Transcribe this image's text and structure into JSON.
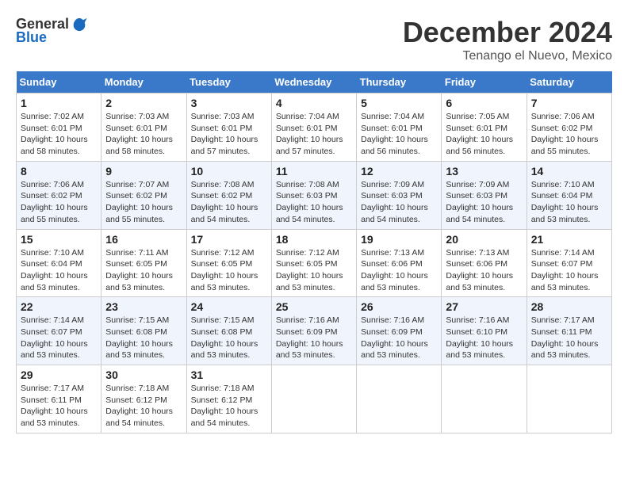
{
  "header": {
    "logo_general": "General",
    "logo_blue": "Blue",
    "month_title": "December 2024",
    "location": "Tenango el Nuevo, Mexico"
  },
  "days_of_week": [
    "Sunday",
    "Monday",
    "Tuesday",
    "Wednesday",
    "Thursday",
    "Friday",
    "Saturday"
  ],
  "weeks": [
    [
      {
        "date": "1",
        "sunrise": "7:02 AM",
        "sunset": "6:01 PM",
        "daylight": "10 hours and 58 minutes."
      },
      {
        "date": "2",
        "sunrise": "7:03 AM",
        "sunset": "6:01 PM",
        "daylight": "10 hours and 58 minutes."
      },
      {
        "date": "3",
        "sunrise": "7:03 AM",
        "sunset": "6:01 PM",
        "daylight": "10 hours and 57 minutes."
      },
      {
        "date": "4",
        "sunrise": "7:04 AM",
        "sunset": "6:01 PM",
        "daylight": "10 hours and 57 minutes."
      },
      {
        "date": "5",
        "sunrise": "7:04 AM",
        "sunset": "6:01 PM",
        "daylight": "10 hours and 56 minutes."
      },
      {
        "date": "6",
        "sunrise": "7:05 AM",
        "sunset": "6:01 PM",
        "daylight": "10 hours and 56 minutes."
      },
      {
        "date": "7",
        "sunrise": "7:06 AM",
        "sunset": "6:02 PM",
        "daylight": "10 hours and 55 minutes."
      }
    ],
    [
      {
        "date": "8",
        "sunrise": "7:06 AM",
        "sunset": "6:02 PM",
        "daylight": "10 hours and 55 minutes."
      },
      {
        "date": "9",
        "sunrise": "7:07 AM",
        "sunset": "6:02 PM",
        "daylight": "10 hours and 55 minutes."
      },
      {
        "date": "10",
        "sunrise": "7:08 AM",
        "sunset": "6:02 PM",
        "daylight": "10 hours and 54 minutes."
      },
      {
        "date": "11",
        "sunrise": "7:08 AM",
        "sunset": "6:03 PM",
        "daylight": "10 hours and 54 minutes."
      },
      {
        "date": "12",
        "sunrise": "7:09 AM",
        "sunset": "6:03 PM",
        "daylight": "10 hours and 54 minutes."
      },
      {
        "date": "13",
        "sunrise": "7:09 AM",
        "sunset": "6:03 PM",
        "daylight": "10 hours and 54 minutes."
      },
      {
        "date": "14",
        "sunrise": "7:10 AM",
        "sunset": "6:04 PM",
        "daylight": "10 hours and 53 minutes."
      }
    ],
    [
      {
        "date": "15",
        "sunrise": "7:10 AM",
        "sunset": "6:04 PM",
        "daylight": "10 hours and 53 minutes."
      },
      {
        "date": "16",
        "sunrise": "7:11 AM",
        "sunset": "6:05 PM",
        "daylight": "10 hours and 53 minutes."
      },
      {
        "date": "17",
        "sunrise": "7:12 AM",
        "sunset": "6:05 PM",
        "daylight": "10 hours and 53 minutes."
      },
      {
        "date": "18",
        "sunrise": "7:12 AM",
        "sunset": "6:05 PM",
        "daylight": "10 hours and 53 minutes."
      },
      {
        "date": "19",
        "sunrise": "7:13 AM",
        "sunset": "6:06 PM",
        "daylight": "10 hours and 53 minutes."
      },
      {
        "date": "20",
        "sunrise": "7:13 AM",
        "sunset": "6:06 PM",
        "daylight": "10 hours and 53 minutes."
      },
      {
        "date": "21",
        "sunrise": "7:14 AM",
        "sunset": "6:07 PM",
        "daylight": "10 hours and 53 minutes."
      }
    ],
    [
      {
        "date": "22",
        "sunrise": "7:14 AM",
        "sunset": "6:07 PM",
        "daylight": "10 hours and 53 minutes."
      },
      {
        "date": "23",
        "sunrise": "7:15 AM",
        "sunset": "6:08 PM",
        "daylight": "10 hours and 53 minutes."
      },
      {
        "date": "24",
        "sunrise": "7:15 AM",
        "sunset": "6:08 PM",
        "daylight": "10 hours and 53 minutes."
      },
      {
        "date": "25",
        "sunrise": "7:16 AM",
        "sunset": "6:09 PM",
        "daylight": "10 hours and 53 minutes."
      },
      {
        "date": "26",
        "sunrise": "7:16 AM",
        "sunset": "6:09 PM",
        "daylight": "10 hours and 53 minutes."
      },
      {
        "date": "27",
        "sunrise": "7:16 AM",
        "sunset": "6:10 PM",
        "daylight": "10 hours and 53 minutes."
      },
      {
        "date": "28",
        "sunrise": "7:17 AM",
        "sunset": "6:11 PM",
        "daylight": "10 hours and 53 minutes."
      }
    ],
    [
      {
        "date": "29",
        "sunrise": "7:17 AM",
        "sunset": "6:11 PM",
        "daylight": "10 hours and 53 minutes."
      },
      {
        "date": "30",
        "sunrise": "7:18 AM",
        "sunset": "6:12 PM",
        "daylight": "10 hours and 54 minutes."
      },
      {
        "date": "31",
        "sunrise": "7:18 AM",
        "sunset": "6:12 PM",
        "daylight": "10 hours and 54 minutes."
      },
      null,
      null,
      null,
      null
    ]
  ]
}
